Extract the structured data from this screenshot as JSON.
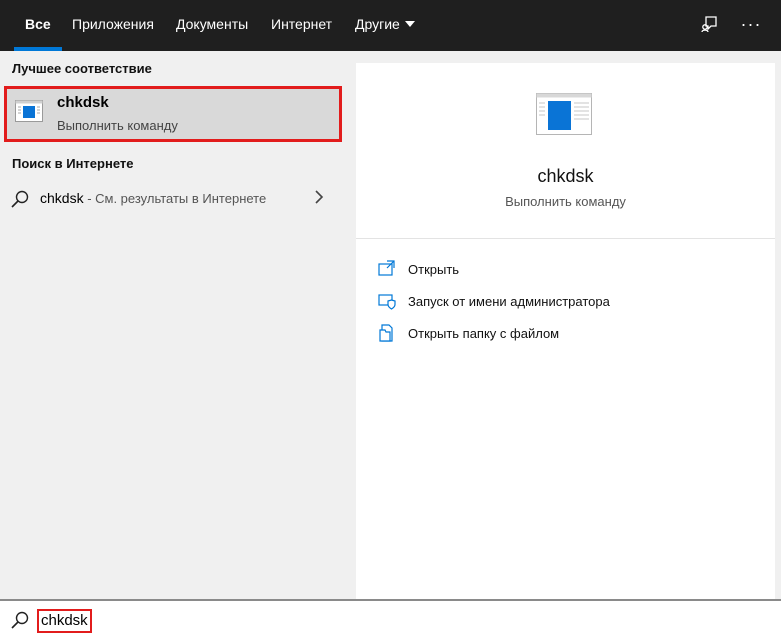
{
  "tabs": [
    {
      "label": "Все",
      "active": true
    },
    {
      "label": "Приложения"
    },
    {
      "label": "Документы"
    },
    {
      "label": "Интернет"
    },
    {
      "label": "Другие"
    }
  ],
  "top_icons": [
    "feedback-icon",
    "more-options-icon"
  ],
  "more_label": "···",
  "best_match": {
    "section_title": "Лучшее соответствие",
    "name": "chkdsk",
    "subtitle": "Выполнить команду",
    "icon": "app-window-icon"
  },
  "web_search": {
    "section_title": "Поиск в Интернете",
    "query": "chkdsk",
    "suffix": " - См. результаты в Интернете"
  },
  "preview": {
    "name": "chkdsk",
    "subtitle": "Выполнить команду",
    "actions": [
      {
        "label": "Открыть",
        "icon": "open-icon"
      },
      {
        "label": "Запуск от имени администратора",
        "icon": "shield-icon"
      },
      {
        "label": "Открыть папку с файлом",
        "icon": "folder-file-icon"
      }
    ]
  },
  "search": {
    "value": "chkdsk"
  },
  "colors": {
    "accent": "#0078d7",
    "highlight": "#e21c1c",
    "topbar": "#1f1f1f"
  }
}
